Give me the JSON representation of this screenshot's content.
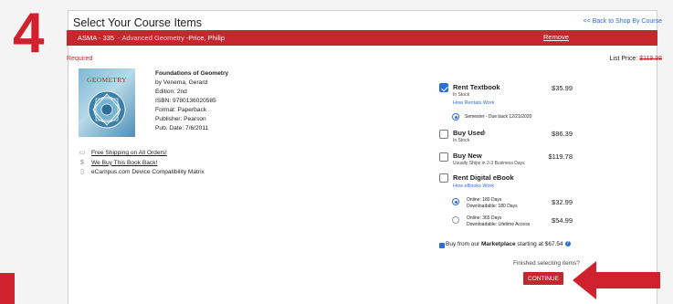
{
  "step_number": "4",
  "header": {
    "title": "Select Your Course Items",
    "back_link": "<< Back to Shop By Course"
  },
  "course": {
    "code": "ASMA - 335",
    "separator": " - ",
    "name": "Advanced Geometry",
    "instructor_sep": " - ",
    "instructor": "Price, Philip",
    "remove_label": "Remove"
  },
  "required_label": "Required",
  "list_price": {
    "label": "List Price: ",
    "value": "$119.98"
  },
  "book": {
    "cover_title": "GEOMETRY",
    "title": "Foundations of Geometry",
    "author": "by Venema, Gerard",
    "edition": "Edition: 2nd",
    "isbn": "ISBN: 9780136020585",
    "format": "Format: Paperback",
    "publisher": "Publisher: Pearson",
    "pub_date": "Pub. Date: 7/6/2011"
  },
  "links": {
    "shipping": "Free Shipping on All Orders!",
    "buyback": "We Buy This Book Back!",
    "compat": "eCampus.com Device Compatibility Matrix"
  },
  "options": {
    "rent": {
      "title": "Rent Textbook",
      "stock": "In Stock",
      "link": "How Rentals Work",
      "price": "$35.99",
      "radio_label": "Semester - Due back 12/21/2020",
      "checked": true
    },
    "used": {
      "title": "Buy Used",
      "stock": "In Stock",
      "price": "$86.39",
      "checked": false
    },
    "new": {
      "title": "Buy New",
      "stock": "Usually Ships in 2-3 Business Days",
      "price": "$119.78",
      "checked": false
    },
    "ebook": {
      "title": "Rent Digital eBook",
      "link": "How eBooks Work",
      "checked": false,
      "choices": [
        {
          "line1": "Online: 180 Days",
          "line2": "Downloadable: 180 Days",
          "price": "$32.99",
          "selected": true
        },
        {
          "line1": "Online: 365 Days",
          "line2": "Downloadable: Lifetime Access",
          "price": "$54.99",
          "selected": false
        }
      ]
    }
  },
  "marketplace": {
    "prefix": "Buy from our ",
    "bold": "Marketplace",
    "suffix": " starting at $67.54"
  },
  "finish_text": "Finished selecting items?",
  "continue_label": "CONTINUE",
  "colors": {
    "accent_red": "#c6262e",
    "link_blue": "#2b6fd6",
    "step_red": "#d0222e"
  }
}
